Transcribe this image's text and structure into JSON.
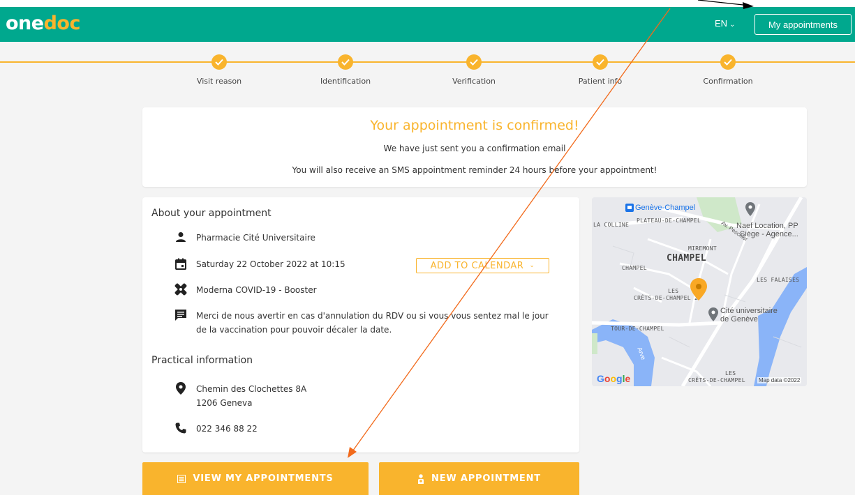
{
  "header": {
    "logo_one": "one",
    "logo_doc": "doc",
    "language": "EN",
    "my_appointments": "My appointments"
  },
  "steps": [
    {
      "label": "Visit reason"
    },
    {
      "label": "Identification"
    },
    {
      "label": "Verification"
    },
    {
      "label": "Patient info"
    },
    {
      "label": "Confirmation"
    }
  ],
  "confirmation": {
    "title": "Your appointment is confirmed!",
    "email_line": "We have just sent you a confirmation email",
    "sms_line": "You will also receive an SMS appointment reminder 24 hours before your appointment!"
  },
  "appointment": {
    "section_title": "About your appointment",
    "pharmacy": "Pharmacie Cité Universitaire",
    "datetime": "Saturday 22 October 2022 at 10:15",
    "add_to_calendar": "ADD TO CALENDAR",
    "vaccine": "Moderna COVID-19 - Booster",
    "note": "Merci de nous avertir en cas d'annulation du RDV ou si vous vous sentez mal le jour de la vaccination pour pouvoir décaler la date."
  },
  "practical": {
    "section_title": "Practical information",
    "address_line1": "Chemin des Clochettes 8A",
    "address_line2": "1206 Geneva",
    "phone": "022 346 88 22"
  },
  "map": {
    "labels": {
      "geneve_champel": "Genève-Champel",
      "la_colline": "LA COLLINE",
      "plateau": "PLATEAU-DE-CHAMPEL",
      "naef1": "Naef Location, PP",
      "naef2": "Siège - Agence...",
      "peschier": "Av. Peschier",
      "miremont": "MIREMONT",
      "champel_big": "CHAMPEL",
      "champel_small": "CHAMPEL",
      "les_falaises": "LES FALAISES",
      "crets1_a": "LES",
      "crets1_b": "CRÊTS-DE-CHAMPEL 2",
      "cite1": "Cité universitaire",
      "cite2": "de Genève",
      "tour": "TOUR-DE-CHAMPEL",
      "arve": "Arve",
      "crets2_a": "LES",
      "crets2_b": "CRÊTS-DE-CHAMPEL",
      "google": "Google",
      "map_data": "Map data ©2022"
    }
  },
  "buttons": {
    "view_appointments": "VIEW MY APPOINTMENTS",
    "new_appointment": "NEW APPOINTMENT"
  },
  "colors": {
    "brand_green": "#00a88e",
    "accent_orange": "#f9b42d",
    "annotation_arrow": "#f26a1b"
  }
}
